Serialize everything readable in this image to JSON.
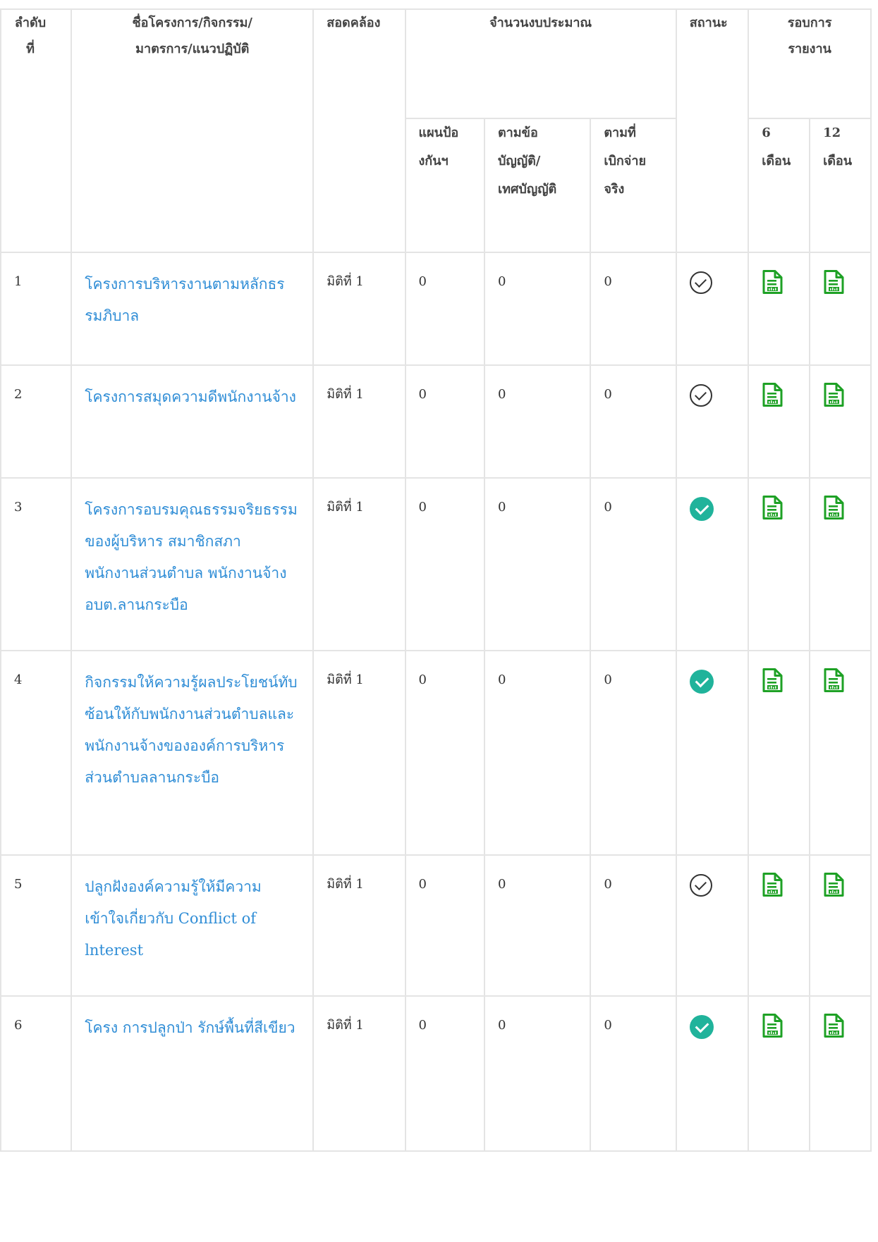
{
  "table": {
    "headers": {
      "order": "ลำดับที่",
      "project_name": "ชื่อโครงการ/กิจกรรม/มาตรการ/แนวปฏิบัติ",
      "alignment": "สอดคล้อง",
      "budget_group": "จำนวนงบประมาณ",
      "budget_plan": "แผนป้องกันฯ",
      "budget_regulation": "ตามข้อบัญญัติ/เทศบัญญัติ",
      "budget_actual": "ตามที่เบิกจ่ายจริง",
      "status": "สถานะ",
      "report_group": "รอบการรายงาน",
      "report_6": "6 เดือน",
      "report_12": "12 เดือน"
    },
    "rows": [
      {
        "no": "1",
        "name": "โครงการบริหารงานตามหลักธรรมภิบาล",
        "alignment": "มิติที่ 1",
        "plan": "0",
        "regulation": "0",
        "actual": "0",
        "status": "pending"
      },
      {
        "no": "2",
        "name": "โครงการสมุดความดีพนักงานจ้าง",
        "alignment": "มิติที่ 1",
        "plan": "0",
        "regulation": "0",
        "actual": "0",
        "status": "pending"
      },
      {
        "no": "3",
        "name": "โครงการอบรมคุณธรรมจริยธรรมของผู้บริหาร สมาชิกสภา พนักงานส่วนตำบล พนักงานจ้าง อบต.ลานกระบือ",
        "alignment": "มิติที่ 1",
        "plan": "0",
        "regulation": "0",
        "actual": "0",
        "status": "done"
      },
      {
        "no": "4",
        "name": "กิจกรรมให้ความรู้ผลประโยชน์ทับซ้อนให้กับพนักงานส่วนตำบลและพนักงานจ้างขององค์การบริหารส่วนตำบลลานกระบือ",
        "alignment": "มิติที่ 1",
        "plan": "0",
        "regulation": "0",
        "actual": "0",
        "status": "done"
      },
      {
        "no": "5",
        "name": "ปลูกฝังองค์ความรู้ให้มีความเข้าใจเกี่ยวกับ Conflict of lnterest",
        "alignment": "มิติที่ 1",
        "plan": "0",
        "regulation": "0",
        "actual": "0",
        "status": "pending"
      },
      {
        "no": "6",
        "name": "โครง การปลูกป่า รักษ์พื้นที่สีเขียว",
        "alignment": "มิติที่ 1",
        "plan": "0",
        "regulation": "0",
        "actual": "0",
        "status": "done"
      }
    ]
  },
  "icons": {
    "status_pending": "check-circle-outline-icon",
    "status_done": "check-circle-filled-icon",
    "report": "spreadsheet-report-icon"
  },
  "colors": {
    "link": "#2f8dd6",
    "done": "#20b39b",
    "report_icon": "#1ea125",
    "border": "#e4e4e4"
  }
}
